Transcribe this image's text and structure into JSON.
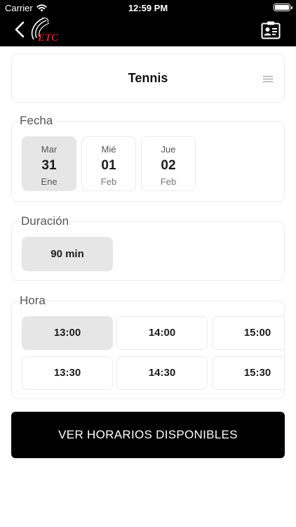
{
  "status_bar": {
    "carrier": "Carrier",
    "time": "12:59 PM"
  },
  "header": {
    "back_icon": "chevron-left-icon",
    "logo": "club-logo",
    "profile_icon": "id-card-icon"
  },
  "sport": {
    "title": "Tennis",
    "menu_icon": "menu-icon"
  },
  "fecha": {
    "label": "Fecha",
    "dates": [
      {
        "dow": "Mar",
        "day": "31",
        "month": "Ene",
        "selected": true
      },
      {
        "dow": "Mié",
        "day": "01",
        "month": "Feb",
        "selected": false
      },
      {
        "dow": "Jue",
        "day": "02",
        "month": "Feb",
        "selected": false
      }
    ]
  },
  "duracion": {
    "label": "Duración",
    "options": [
      {
        "label": "90 min",
        "selected": true
      }
    ]
  },
  "hora": {
    "label": "Hora",
    "times": [
      {
        "label": "13:00",
        "selected": true
      },
      {
        "label": "14:00",
        "selected": false
      },
      {
        "label": "15:00",
        "selected": false
      },
      {
        "label": "13:30",
        "selected": false
      },
      {
        "label": "14:30",
        "selected": false
      },
      {
        "label": "15:30",
        "selected": false
      }
    ]
  },
  "cta": {
    "label": "VER HORARIOS DISPONIBLES"
  },
  "colors": {
    "header_bg": "#000000",
    "selected_bg": "#e6e6e6",
    "logo_red": "#d0202a"
  }
}
